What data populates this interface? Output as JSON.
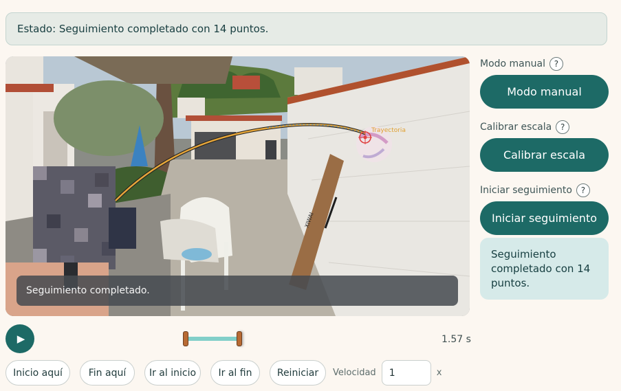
{
  "status": {
    "text": "Estado: Seguimiento completado con 14 puntos."
  },
  "video": {
    "toast": "Seguimiento completado.",
    "trajectory_label": "Trayectoria",
    "box_label": "XIWAI"
  },
  "sidebar": {
    "sections": [
      {
        "label": "Modo manual",
        "help": "?",
        "button": "Modo manual"
      },
      {
        "label": "Calibrar escala",
        "help": "?",
        "button": "Calibrar escala"
      },
      {
        "label": "Iniciar seguimiento",
        "help": "?",
        "button": "Iniciar seguimiento"
      }
    ],
    "info": "Seguimiento completado con 14 puntos."
  },
  "playback": {
    "play_icon": "▶",
    "time": "1.57 s"
  },
  "controls": {
    "buttons": [
      "Inicio aquí",
      "Fin aquí",
      "Ir al inicio",
      "Ir al fin",
      "Reiniciar"
    ],
    "speed_label": "Velocidad",
    "speed_value": "1",
    "speed_unit": "x"
  },
  "colors": {
    "accent": "#1d6a66",
    "trajectory": "#e0a030",
    "range": "#82cfc9"
  }
}
